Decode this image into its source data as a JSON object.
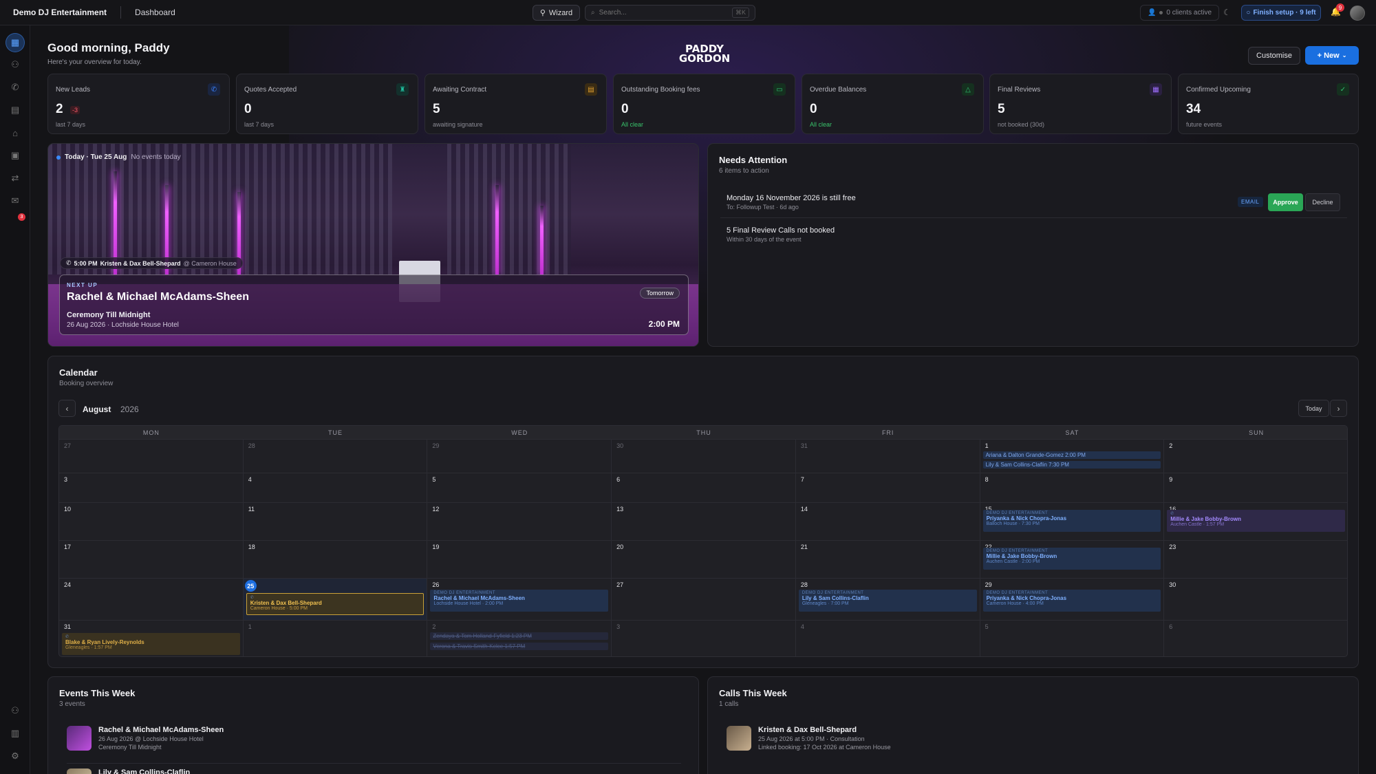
{
  "topbar": {
    "brand": "Demo DJ Entertainment",
    "page": "Dashboard",
    "wizard": "Wizard",
    "search_placeholder": "Search...",
    "search_shortcut": "⌘K",
    "clients": "0 clients active",
    "finish_setup": "Finish setup · 9 left",
    "notif_count": "9"
  },
  "sidebar": {
    "inbox_badge": "3"
  },
  "header": {
    "greeting": "Good morning, Paddy",
    "subtitle": "Here's your overview for today.",
    "logo_line1": "PADDY",
    "logo_line2": "GORDON",
    "customise": "Customise",
    "new": "+ New"
  },
  "stats": [
    {
      "label": "New Leads",
      "value": "2",
      "delta": "-3",
      "sub": "last 7 days",
      "icon": "phone-icon",
      "color": "#3a82ff"
    },
    {
      "label": "Quotes Accepted",
      "value": "0",
      "sub": "last 7 days",
      "icon": "trophy-icon",
      "color": "#20c0a0"
    },
    {
      "label": "Awaiting Contract",
      "value": "5",
      "sub": "awaiting signature",
      "icon": "document-icon",
      "color": "#e0a030"
    },
    {
      "label": "Outstanding Booking fees",
      "value": "0",
      "sub": "All clear",
      "icon": "card-icon",
      "color": "#30c070"
    },
    {
      "label": "Overdue Balances",
      "value": "0",
      "sub": "All clear",
      "icon": "warning-icon",
      "color": "#30c070"
    },
    {
      "label": "Final Reviews",
      "value": "5",
      "sub": "not booked (30d)",
      "icon": "calendar-icon",
      "color": "#a070ff"
    },
    {
      "label": "Confirmed Upcoming",
      "value": "34",
      "sub": "future events",
      "icon": "check-circle-icon",
      "color": "#30c070"
    }
  ],
  "hero": {
    "today": "Today · Tue 25 Aug",
    "no_events": "No events today",
    "call_time": "5:00 PM",
    "call_name": "Kristen & Dax Bell-Shepard",
    "call_venue": "@ Cameron House",
    "next_up": "NEXT UP",
    "next_name": "Rachel & Michael McAdams-Sheen",
    "next_package": "Ceremony Till Midnight",
    "next_where": "26 Aug 2026 · Lochside House Hotel",
    "next_when": "Tomorrow",
    "next_time": "2:00 PM"
  },
  "attention": {
    "title": "Needs Attention",
    "subtitle": "6 items to action",
    "items": [
      {
        "title": "Monday 16 November 2026 is still free",
        "sub": "To: Followup Test · 6d ago",
        "tag": "EMAIL",
        "approve": "Approve",
        "decline": "Decline"
      },
      {
        "title": "5 Final Review Calls not booked",
        "sub": "Within 30 days of the event"
      }
    ]
  },
  "calendar": {
    "title": "Calendar",
    "subtitle": "Booking overview",
    "month": "August",
    "year": "2026",
    "today": "Today",
    "weekdays": [
      "MON",
      "TUE",
      "WED",
      "THU",
      "FRI",
      "SAT",
      "SUN"
    ],
    "weeks": [
      [
        "27",
        "28",
        "29",
        "30",
        "31",
        "1",
        "2"
      ],
      [
        "3",
        "4",
        "5",
        "6",
        "7",
        "8",
        "9"
      ],
      [
        "10",
        "11",
        "12",
        "13",
        "14",
        "15",
        "16"
      ],
      [
        "17",
        "18",
        "19",
        "20",
        "21",
        "22",
        "23"
      ],
      [
        "24",
        "25",
        "26",
        "27",
        "28",
        "29",
        "30"
      ],
      [
        "31",
        "1",
        "2",
        "3",
        "4",
        "5",
        "6"
      ]
    ],
    "org": "DEMO DJ ENTERTAINMENT",
    "events": {
      "sat1a": "Ariana & Dalton Grande-Gomez 2:00 PM",
      "sat1b": "Lily & Sam Collins-Claflin 7:30 PM",
      "aug15_name": "Priyanka & Nick Chopra-Jonas",
      "aug15_loc": "Balloch House · 7:30 PM",
      "aug16_name": "Millie & Jake Bobby-Brown",
      "aug16_loc": "Auchen Castle · 1:57 PM",
      "aug22_name": "Millie & Jake Bobby-Brown",
      "aug22_loc": "Auchen Castle · 2:00 PM",
      "aug25_name": "Kristen & Dax Bell-Shepard",
      "aug25_loc": "Cameron House · 5:00 PM",
      "aug26_name": "Rachel & Michael McAdams-Sheen",
      "aug26_loc": "Lochside House Hotel · 2:00 PM",
      "aug28_name": "Lily & Sam Collins-Claflin",
      "aug28_loc": "Gleneagles · 7:00 PM",
      "aug29_name": "Priyanka & Nick Chopra-Jonas",
      "aug29_loc": "Cameron House · 4:00 PM",
      "aug31_name": "Blake & Ryan Lively-Reynolds",
      "aug31_loc": "Gleneagles · 1:57 PM",
      "sep2a": "Zendaya & Tom Holland-Fyfield 1:23 PM",
      "sep2b": "Verona & Travis Smith-Kelce 1:57 PM"
    }
  },
  "events_week": {
    "title": "Events This Week",
    "subtitle": "3 events",
    "items": [
      {
        "name": "Rachel & Michael McAdams-Sheen",
        "line1": "26 Aug 2026 @ Lochside House Hotel",
        "line2": "Ceremony Till Midnight"
      },
      {
        "name": "Lily & Sam Collins-Claflin"
      }
    ]
  },
  "calls_week": {
    "title": "Calls This Week",
    "subtitle": "1 calls",
    "items": [
      {
        "name": "Kristen & Dax Bell-Shepard",
        "line1": "25 Aug 2026 at 5:00 PM · Consultation",
        "line2": "Linked booking: 17 Oct 2026 at Cameron House"
      }
    ]
  }
}
